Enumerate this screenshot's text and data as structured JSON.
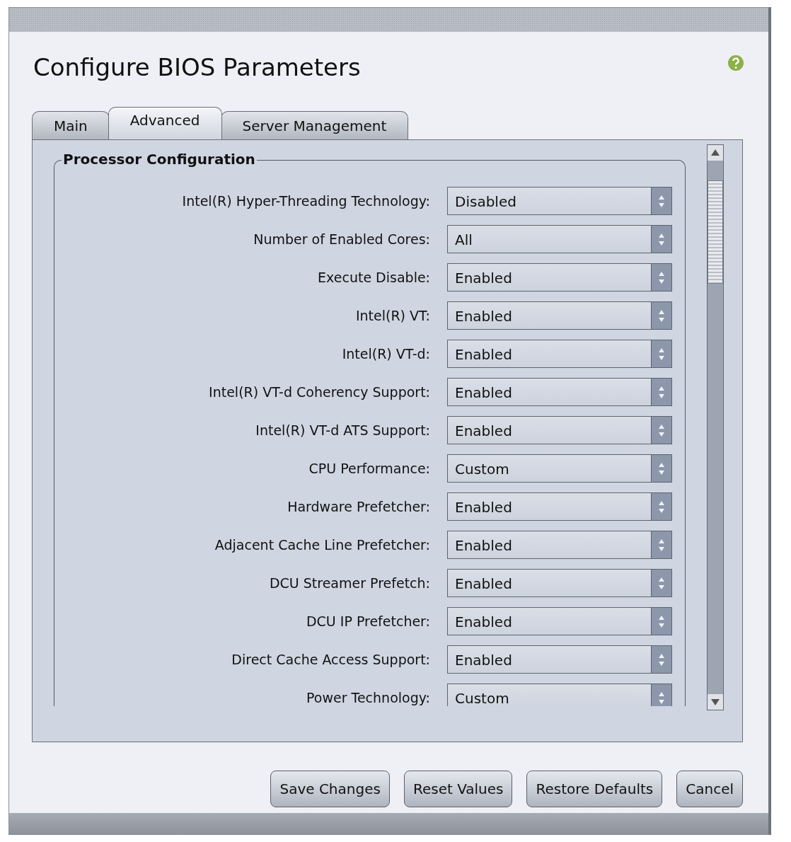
{
  "window": {
    "title": "Configure BIOS Parameters"
  },
  "tabs": [
    {
      "label": "Main",
      "selected": false
    },
    {
      "label": "Advanced",
      "selected": true
    },
    {
      "label": "Server Management",
      "selected": false
    }
  ],
  "section": {
    "title": "Processor Configuration"
  },
  "settings": [
    {
      "label": "Intel(R) Hyper-Threading Technology:",
      "value": "Disabled"
    },
    {
      "label": "Number of Enabled Cores:",
      "value": "All"
    },
    {
      "label": "Execute Disable:",
      "value": "Enabled"
    },
    {
      "label": "Intel(R) VT:",
      "value": "Enabled"
    },
    {
      "label": "Intel(R) VT-d:",
      "value": "Enabled"
    },
    {
      "label": "Intel(R) VT-d Coherency Support:",
      "value": "Enabled"
    },
    {
      "label": "Intel(R) VT-d ATS Support:",
      "value": "Enabled"
    },
    {
      "label": "CPU Performance:",
      "value": "Custom"
    },
    {
      "label": "Hardware Prefetcher:",
      "value": "Enabled"
    },
    {
      "label": "Adjacent Cache Line Prefetcher:",
      "value": "Enabled"
    },
    {
      "label": "DCU Streamer Prefetch:",
      "value": "Enabled"
    },
    {
      "label": "DCU IP Prefetcher:",
      "value": "Enabled"
    },
    {
      "label": "Direct Cache Access Support:",
      "value": "Enabled"
    },
    {
      "label": "Power Technology:",
      "value": "Custom"
    }
  ],
  "buttons": [
    "Save Changes",
    "Reset Values",
    "Restore Defaults",
    "Cancel"
  ]
}
